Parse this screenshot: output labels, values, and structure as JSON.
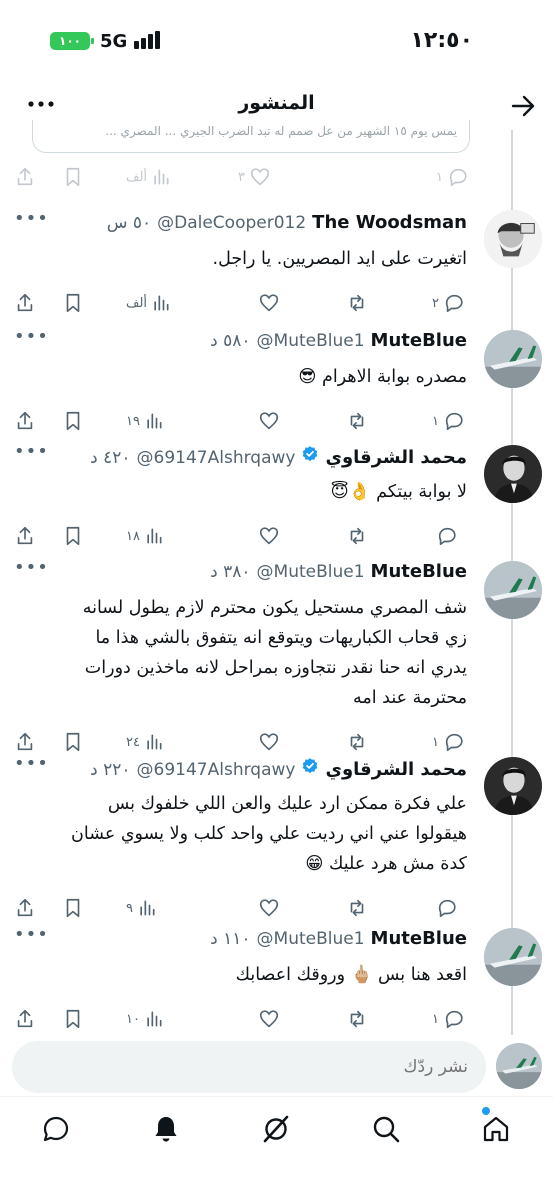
{
  "status": {
    "time": "١٢:٥٠",
    "battery": "١٠٠",
    "network": "5G"
  },
  "header": {
    "title": "المنشور",
    "back_icon": "arrow-right-icon",
    "more_icon": "more-horizontal-icon"
  },
  "quote": {
    "text": "يمس يوم ١٥ الشهير من عل صمم له تبد الضرب الجيري ... المصري ..."
  },
  "first_actions": {
    "reply": "١",
    "like": "٣",
    "views": "ألف"
  },
  "posts": [
    {
      "name": "The Woodsman",
      "handle": "@DaleCooper012",
      "time": "٥٠ س",
      "verified": false,
      "avatar": "woodsman-avatar",
      "text": [
        "اتغيرت على ايد المصريين. يا راجل."
      ],
      "reply": "٢",
      "like": "",
      "views": "ألف"
    },
    {
      "name": "MuteBlue",
      "handle": "@MuteBlue1",
      "time": "٥٨٠ د",
      "verified": false,
      "avatar": "airplane-avatar",
      "text": [
        "مصدره بوابة الاهرام 😎"
      ],
      "reply": "١",
      "like": "",
      "views": "١٩"
    },
    {
      "name": "محمد الشرقاوي",
      "handle": "@69147Alshrqawy",
      "time": "٤٢٠ د",
      "verified": true,
      "avatar": "man-avatar",
      "text": [
        "لا بوابة بيتكم 👌😇"
      ],
      "reply": "",
      "like": "",
      "views": "١٨"
    },
    {
      "name": "MuteBlue",
      "handle": "@MuteBlue1",
      "time": "٣٨٠ د",
      "verified": false,
      "avatar": "airplane-avatar",
      "text": [
        "شف المصري مستحيل يكون محترم لازم يطول لسانه",
        "زي قحاب الكباريهات ويتوقع انه يتفوق بالشي هذا ما",
        "يدري انه حنا نقدر نتجاوزه بمراحل لانه ماخذين دورات",
        "محترمة عند امه"
      ],
      "reply": "١",
      "like": "",
      "views": "٢٤"
    },
    {
      "name": "محمد الشرقاوي",
      "handle": "@69147Alshrqawy",
      "time": "٢٢٠ د",
      "verified": true,
      "avatar": "man-avatar",
      "text": [
        "علي فكرة ممكن ارد عليك والعن اللي خلفوك بس",
        "هيقولوا عني اني رديت علي واحد كلب ولا يسوي عشان",
        "كدة مش هرد عليك 😁"
      ],
      "reply": "",
      "like": "",
      "views": "٩"
    },
    {
      "name": "MuteBlue",
      "handle": "@MuteBlue1",
      "time": "١١٠ د",
      "verified": false,
      "avatar": "airplane-avatar",
      "text": [
        "اقعد هنا بس 🖕🏼 وروقك اعصابك"
      ],
      "reply": "١",
      "like": "",
      "views": "١٠"
    }
  ],
  "reply_bar": {
    "placeholder": "نشر ردّك"
  },
  "nav": {
    "items": [
      "home-icon",
      "search-icon",
      "grok-icon",
      "notifications-icon",
      "messages-icon"
    ]
  },
  "colors": {
    "verified": "#1d9bf0",
    "muted": "#536471",
    "battery": "#34c759"
  }
}
